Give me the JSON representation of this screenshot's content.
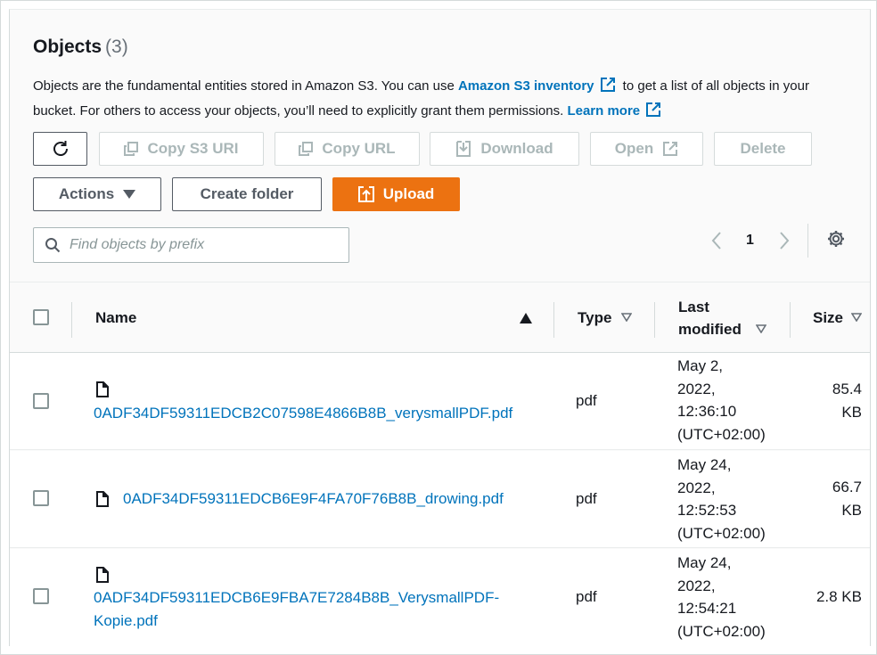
{
  "header": {
    "title": "Objects",
    "count": "(3)"
  },
  "description": {
    "part1": "Objects are the fundamental entities stored in Amazon S3. You can use ",
    "inventory_link": "Amazon S3 inventory",
    "part2": " to get a list of all objects in your bucket. For others to access your objects, you’ll need to explicitly grant them permissions. ",
    "learn_more": "Learn more"
  },
  "toolbar": {
    "copy_s3_uri": "Copy S3 URI",
    "copy_url": "Copy URL",
    "download": "Download",
    "open": "Open",
    "delete": "Delete",
    "actions": "Actions",
    "create_folder": "Create folder",
    "upload": "Upload"
  },
  "search": {
    "placeholder": "Find objects by prefix",
    "value": ""
  },
  "pagination": {
    "current_page": "1"
  },
  "table": {
    "columns": {
      "name": "Name",
      "type": "Type",
      "last_modified_line1": "Last",
      "last_modified_line2": "modified",
      "size": "Size"
    },
    "rows": [
      {
        "name_line1": "0ADF34DF59311EDCB2C07598E4866B8B_verysmallPDF.pdf",
        "name_line2": "",
        "type": "pdf",
        "modified": [
          "May 2,",
          "2022,",
          "12:36:10",
          "(UTC+02:00)"
        ],
        "size": [
          "85.4",
          "KB"
        ]
      },
      {
        "name_line1": "0ADF34DF59311EDCB6E9F4FA70F76B8B_drowing.pdf",
        "name_line2": "",
        "type": "pdf",
        "modified": [
          "May 24,",
          "2022,",
          "12:52:53",
          "(UTC+02:00)"
        ],
        "size": [
          "66.7",
          "KB"
        ]
      },
      {
        "name_line1": "0ADF34DF59311EDCB6E9FBA7E7284B8B_VerysmallPDF-",
        "name_line2": "Kopie.pdf",
        "type": "pdf",
        "modified": [
          "May 24,",
          "2022,",
          "12:54:21",
          "(UTC+02:00)"
        ],
        "size": [
          "2.8 KB",
          ""
        ]
      }
    ]
  },
  "colors": {
    "accent": "#ec7211",
    "link": "#0073bb",
    "text": "#16191f",
    "muted": "#687078"
  }
}
